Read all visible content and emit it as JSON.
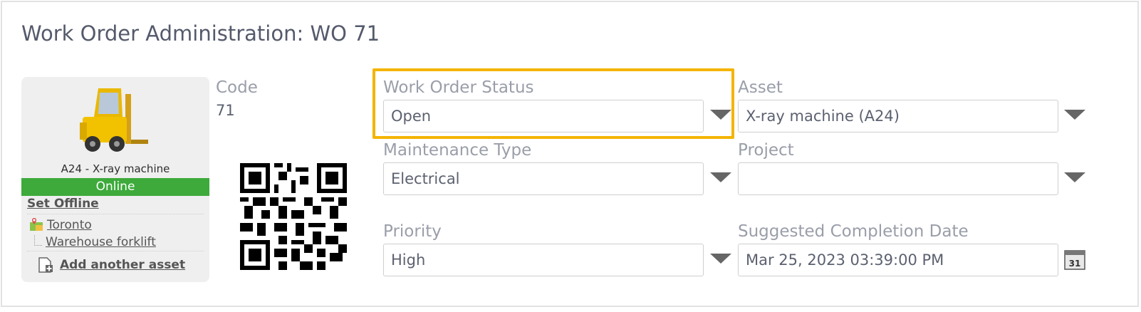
{
  "page": {
    "title": "Work Order Administration: WO 71"
  },
  "asset_card": {
    "name": "A24 - X-ray machine",
    "status": "Online",
    "set_offline": "Set Offline",
    "location": "Toronto",
    "sublocation": "Warehouse forklift",
    "add_asset": "Add another asset",
    "status_color": "#3daa3b",
    "icon": "forklift-icon"
  },
  "code": {
    "label": "Code",
    "value": "71"
  },
  "fields": {
    "status": {
      "label": "Work Order Status",
      "value": "Open"
    },
    "asset": {
      "label": "Asset",
      "value": "X-ray machine (A24)"
    },
    "maintenance_type": {
      "label": "Maintenance Type",
      "value": "Electrical"
    },
    "project": {
      "label": "Project",
      "value": ""
    },
    "priority": {
      "label": "Priority",
      "value": "High"
    },
    "completion_date": {
      "label": "Suggested Completion Date",
      "value": "Mar 25, 2023 03:39:00 PM"
    }
  },
  "calendar": {
    "day": "31",
    "icon": "calendar-icon"
  },
  "colors": {
    "highlight": "#f4b400",
    "online": "#3daa3b"
  }
}
